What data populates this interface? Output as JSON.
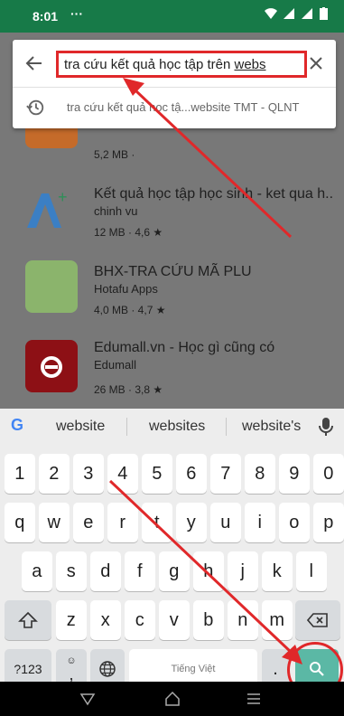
{
  "status_bar": {
    "time": "8:01",
    "dots": "···"
  },
  "search": {
    "query_prefix": "tra cứu kết quả học tập trên ",
    "query_underlined": "webs",
    "suggestion": "tra cứu kết quả học tậ...website TMT - QLNT"
  },
  "apps": [
    {
      "title": "",
      "developer": "",
      "meta": "5,2 MB ·",
      "icon_color": "#1c7a36"
    },
    {
      "title": "Kết quả học tập học sinh - ket qua h..",
      "developer": "chinh vu",
      "meta": "12 MB · 4,6 ★",
      "icon_color": "#2f6fb0"
    },
    {
      "title": "BHX-TRA CỨU MÃ PLU",
      "developer": "Hotafu Apps",
      "meta": "4,0 MB · 4,7 ★",
      "icon_color": "#6a9a4e"
    },
    {
      "title": "Edumall.vn - Học gì cũng có",
      "developer": "Edumall",
      "meta": "26 MB · 3,8 ★",
      "icon_color": "#b01218"
    }
  ],
  "keyboard": {
    "google_logo": "G",
    "suggestions": [
      "website",
      "websites",
      "website's"
    ],
    "row_numbers": [
      "1",
      "2",
      "3",
      "4",
      "5",
      "6",
      "7",
      "8",
      "9",
      "0"
    ],
    "row1": [
      "q",
      "w",
      "e",
      "r",
      "t",
      "y",
      "u",
      "i",
      "o",
      "p"
    ],
    "row2": [
      "a",
      "s",
      "d",
      "f",
      "g",
      "h",
      "j",
      "k",
      "l"
    ],
    "row3": [
      "z",
      "x",
      "c",
      "v",
      "b",
      "n",
      "m"
    ],
    "symbols_label": "?123",
    "emoji_label": "☺",
    "comma_label": ",",
    "space_label": "Tiếng Việt",
    "period_label": "."
  },
  "colors": {
    "status_green": "#177a48",
    "highlight_red": "#e0282a",
    "go_key": "#5bb8a5"
  }
}
